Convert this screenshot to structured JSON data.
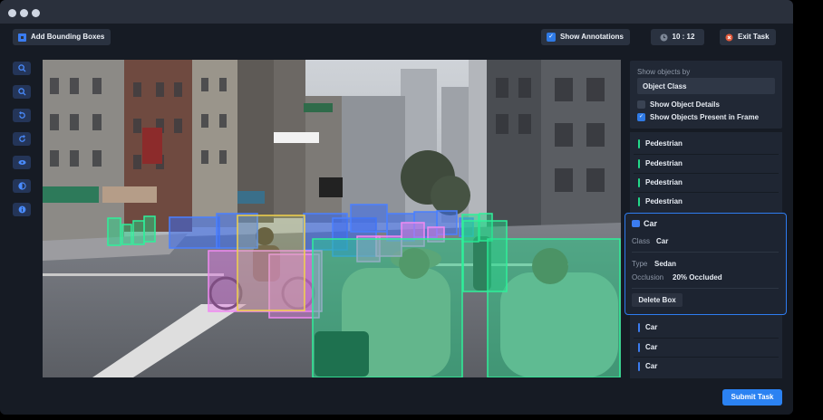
{
  "toolbar": {
    "add_bbox_label": "Add Bounding Boxes",
    "show_annotations_label": "Show Annotations",
    "timer": "10 : 12",
    "exit_label": "Exit Task"
  },
  "filter_panel": {
    "heading": "Show objects by",
    "select_value": "Object Class",
    "opt_details": "Show Object Details",
    "opt_present": "Show Objects Present in Frame"
  },
  "objects_top": [
    {
      "label": "Pedestrian",
      "color": "#22d98a"
    },
    {
      "label": "Pedestrian",
      "color": "#22d98a"
    },
    {
      "label": "Pedestrian",
      "color": "#22d98a"
    },
    {
      "label": "Pedestrian",
      "color": "#22d98a"
    }
  ],
  "selected": {
    "title": "Car",
    "class_key": "Class",
    "class_val": "Car",
    "type_key": "Type",
    "type_val": "Sedan",
    "occlusion_key": "Occlusion",
    "occlusion_val": "20% Occluded",
    "delete_label": "Delete Box"
  },
  "objects_bottom": [
    {
      "label": "Car",
      "color": "#3b7cf0"
    },
    {
      "label": "Car",
      "color": "#3b7cf0"
    },
    {
      "label": "Car",
      "color": "#3b7cf0"
    }
  ],
  "footer": {
    "submit_label": "Submit Task"
  },
  "colors": {
    "accent": "#2e7cf0",
    "pedestrian": "#22d98a",
    "car": "#3b7cf0",
    "bicycle": "#e57be8",
    "rider": "#f2d24b"
  }
}
